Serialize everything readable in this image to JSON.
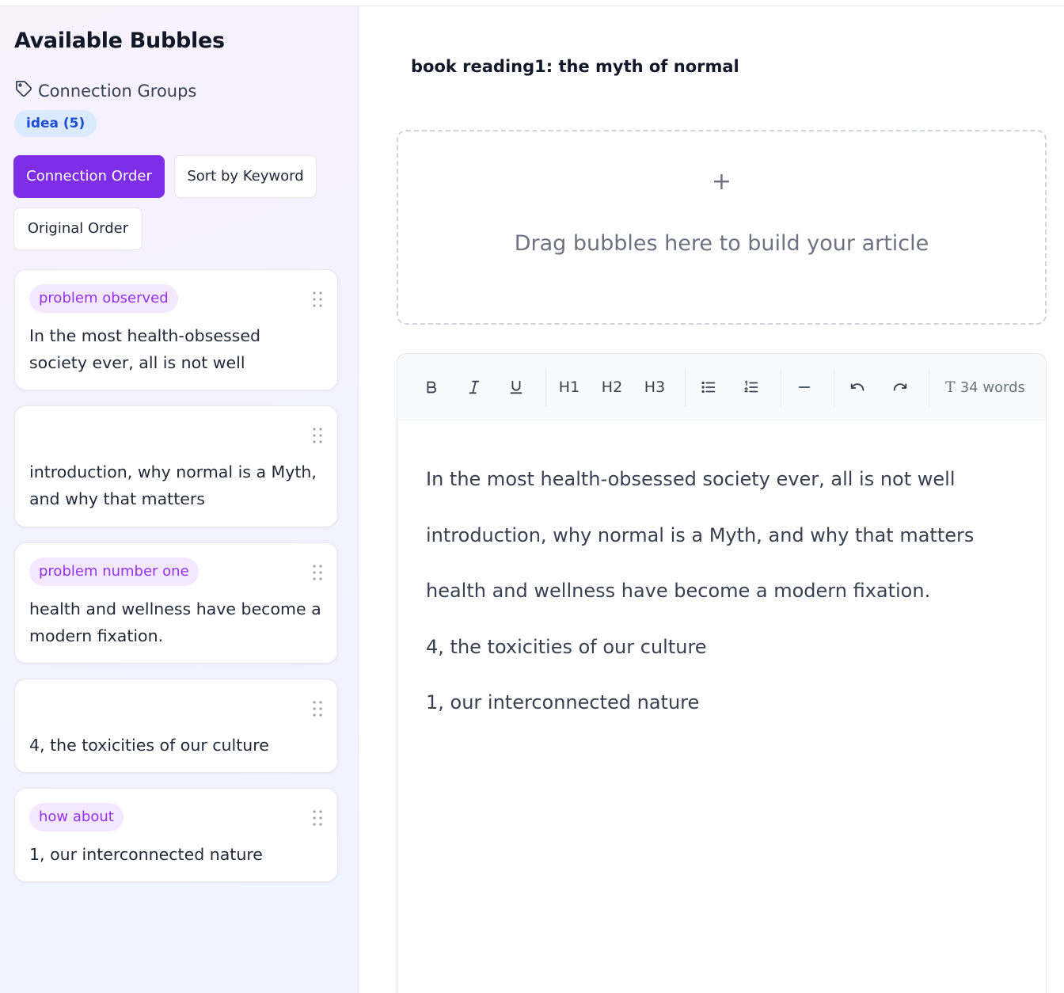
{
  "sidebar": {
    "title": "Available Bubbles",
    "groups_label": "Connection Groups",
    "groups_icon": "tag-icon",
    "group_chip": "idea (5)",
    "buttons": {
      "connection_order": "Connection Order",
      "sort_by_keyword": "Sort by Keyword",
      "original_order": "Original Order"
    },
    "cards": [
      {
        "tag": "problem observed",
        "text": "In the most health-obsessed society ever, all is not well"
      },
      {
        "tag": "",
        "text": "introduction, why normal is a Myth, and why that matters"
      },
      {
        "tag": "problem number one",
        "text": "health and wellness have become a modern fixation."
      },
      {
        "tag": "",
        "text": "4, the toxicities of our culture"
      },
      {
        "tag": "how about",
        "text": "1, our interconnected nature"
      }
    ]
  },
  "main": {
    "doc_title": "book reading1: the myth of normal",
    "dropzone": {
      "plus": "+",
      "hint": "Drag bubbles here to build your article"
    },
    "toolbar": {
      "h1": "H1",
      "h2": "H2",
      "h3": "H3",
      "word_count": "34 words",
      "icons": [
        "bold-icon",
        "italic-icon",
        "underline-icon",
        "bullet-list-icon",
        "numbered-list-icon",
        "horizontal-rule-icon",
        "undo-icon",
        "redo-icon",
        "text-icon"
      ]
    },
    "paragraphs": [
      "In the most health-obsessed society ever, all is not well",
      "introduction, why normal is a Myth, and why that matters",
      "health and wellness have become a modern fixation.",
      "4, the toxicities of our culture",
      "1, our interconnected nature"
    ]
  },
  "colors": {
    "accent": "#7e2ee6",
    "tag_bg": "#f3e8ff",
    "tag_text": "#9333ea",
    "chip_bg": "#dbeafe",
    "chip_text": "#1d4ed8"
  }
}
